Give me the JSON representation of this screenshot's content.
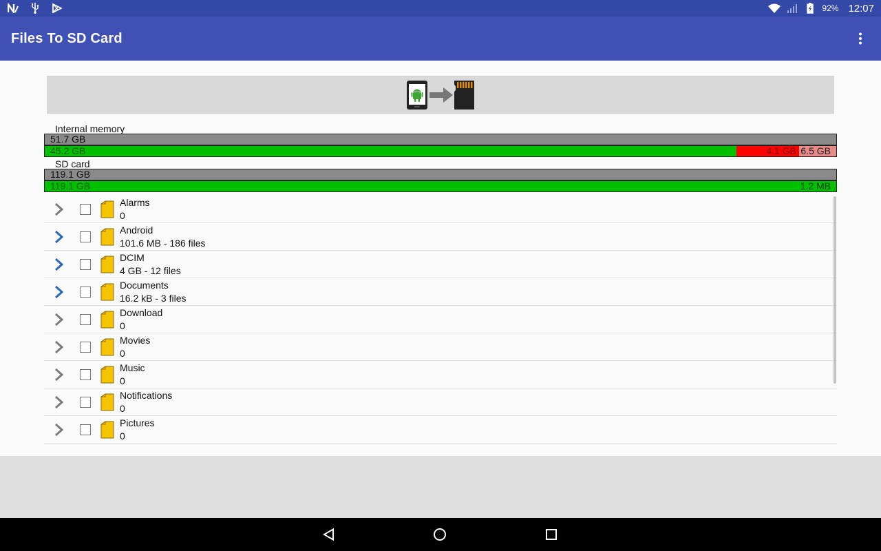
{
  "status_bar": {
    "time": "12:07",
    "battery": "92%",
    "left_icons": [
      "n-notification-icon",
      "usb-icon",
      "play-store-icon"
    ],
    "right_icons": [
      "wifi-icon",
      "signal-icon",
      "battery-icon"
    ]
  },
  "app_bar": {
    "title": "Files To SD Card",
    "overflow_icon": "more-vert-icon"
  },
  "banner": {
    "icon": "phone-to-sd-transfer-icon"
  },
  "colors": {
    "status_bar": "#3448a8",
    "app_bar": "#3f51b5",
    "used_green": "#00c000",
    "other_red": "#ff0000",
    "free_pink": "#e88a8a",
    "total_gray": "#8a8a8a",
    "chevron_blue": "#2a6ab8",
    "chevron_gray": "#7a7a7a",
    "folder_yellow": "#f5c400"
  },
  "storage": {
    "internal": {
      "label": "Internal memory",
      "total": "51.7 GB",
      "used": "45.2 GB",
      "other": "4.1 GB",
      "free": "6.5 GB",
      "used_fraction": 0.874,
      "other_fraction": 0.079,
      "free_fraction": 0.047
    },
    "sd": {
      "label": "SD card",
      "total": "119.1 GB",
      "used": "119.1 GB",
      "free": "1.2 MB",
      "used_fraction": 1.0
    }
  },
  "files": [
    {
      "name": "Alarms",
      "meta": "0",
      "expandable": false
    },
    {
      "name": "Android",
      "meta": "101.6 MB - 186 files",
      "expandable": true
    },
    {
      "name": "DCIM",
      "meta": "4 GB - 12 files",
      "expandable": true
    },
    {
      "name": "Documents",
      "meta": "16.2 kB - 3 files",
      "expandable": true
    },
    {
      "name": "Download",
      "meta": "0",
      "expandable": false
    },
    {
      "name": "Movies",
      "meta": "0",
      "expandable": false
    },
    {
      "name": "Music",
      "meta": "0",
      "expandable": false
    },
    {
      "name": "Notifications",
      "meta": "0",
      "expandable": false
    },
    {
      "name": "Pictures",
      "meta": "0",
      "expandable": false
    }
  ],
  "nav": {
    "back_icon": "back-icon",
    "home_icon": "home-icon",
    "recents_icon": "recents-icon"
  }
}
